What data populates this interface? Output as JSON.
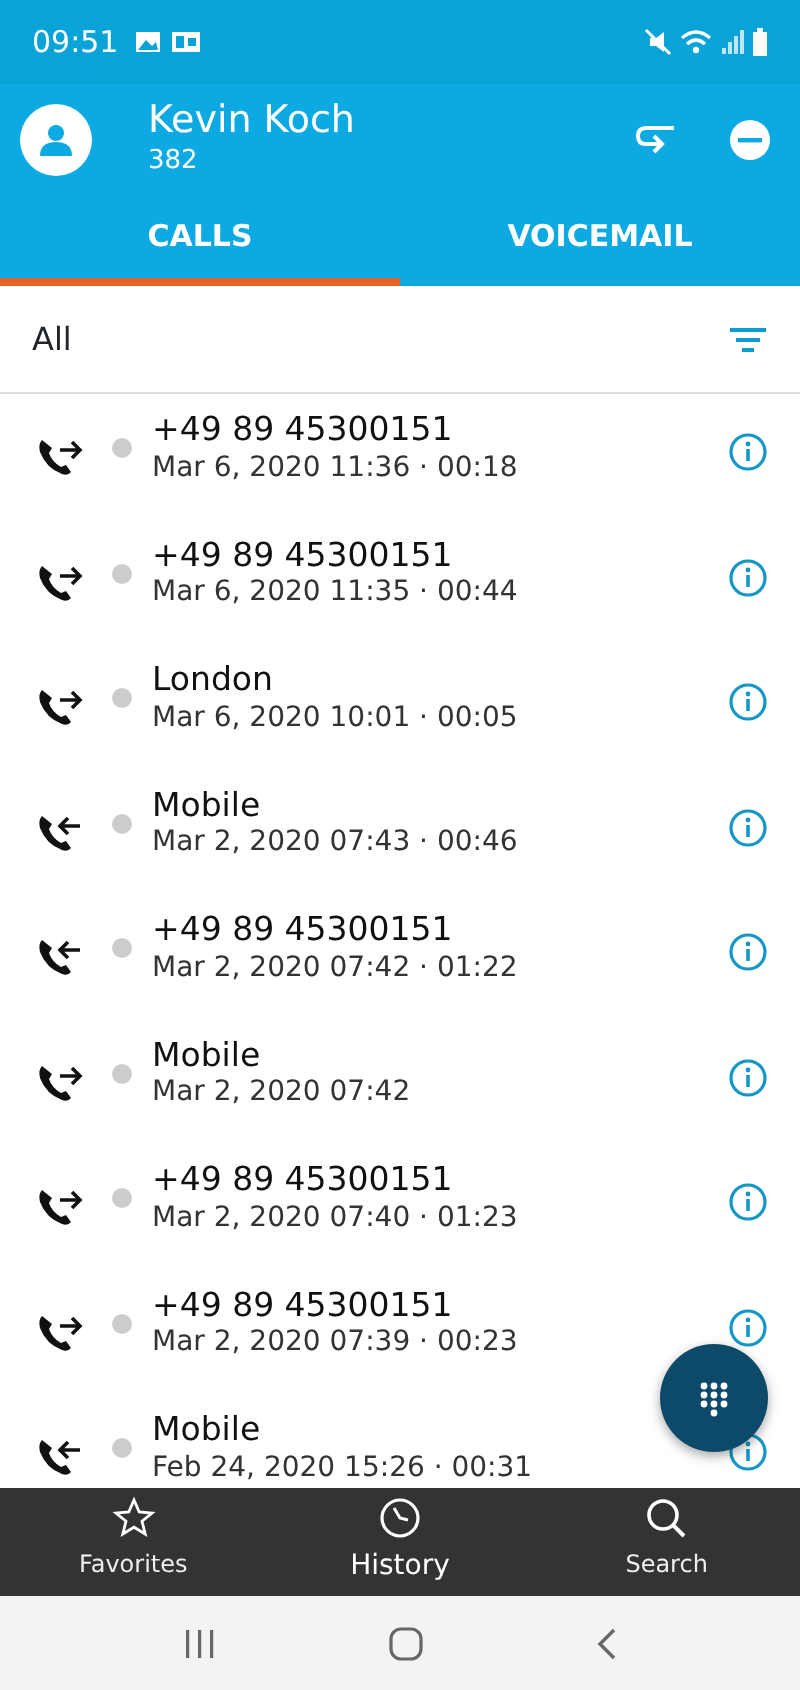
{
  "status_bar": {
    "time": "09:51"
  },
  "header": {
    "name": "Kevin Koch",
    "extension": "382"
  },
  "tabs": [
    {
      "label": "CALLS",
      "selected": true
    },
    {
      "label": "VOICEMAIL",
      "selected": false
    }
  ],
  "filter": {
    "label": "All"
  },
  "calls": [
    {
      "kind": "outgoing",
      "title": "+49 89 45300151",
      "detail": "Mar 6, 2020 11:36 · 00:18"
    },
    {
      "kind": "outgoing",
      "title": "+49 89 45300151",
      "detail": "Mar 6, 2020 11:35 · 00:44"
    },
    {
      "kind": "outgoing",
      "title": "London",
      "detail": "Mar 6, 2020 10:01 · 00:05"
    },
    {
      "kind": "incoming",
      "title": "Mobile",
      "detail": "Mar 2, 2020 07:43 · 00:46"
    },
    {
      "kind": "incoming",
      "title": "+49 89 45300151",
      "detail": "Mar 2, 2020 07:42 · 01:22"
    },
    {
      "kind": "outgoing",
      "title": "Mobile",
      "detail": "Mar 2, 2020 07:42"
    },
    {
      "kind": "outgoing",
      "title": "+49 89 45300151",
      "detail": "Mar 2, 2020 07:40 · 01:23"
    },
    {
      "kind": "outgoing",
      "title": "+49 89 45300151",
      "detail": "Mar 2, 2020 07:39 · 00:23"
    },
    {
      "kind": "incoming",
      "title": "Mobile",
      "detail": "Feb 24, 2020 15:26 · 00:31"
    }
  ],
  "bottom_nav": [
    {
      "kind": "favorites",
      "label": "Favorites",
      "selected": false
    },
    {
      "kind": "history",
      "label": "History",
      "selected": true
    },
    {
      "kind": "search",
      "label": "Search",
      "selected": false
    }
  ]
}
